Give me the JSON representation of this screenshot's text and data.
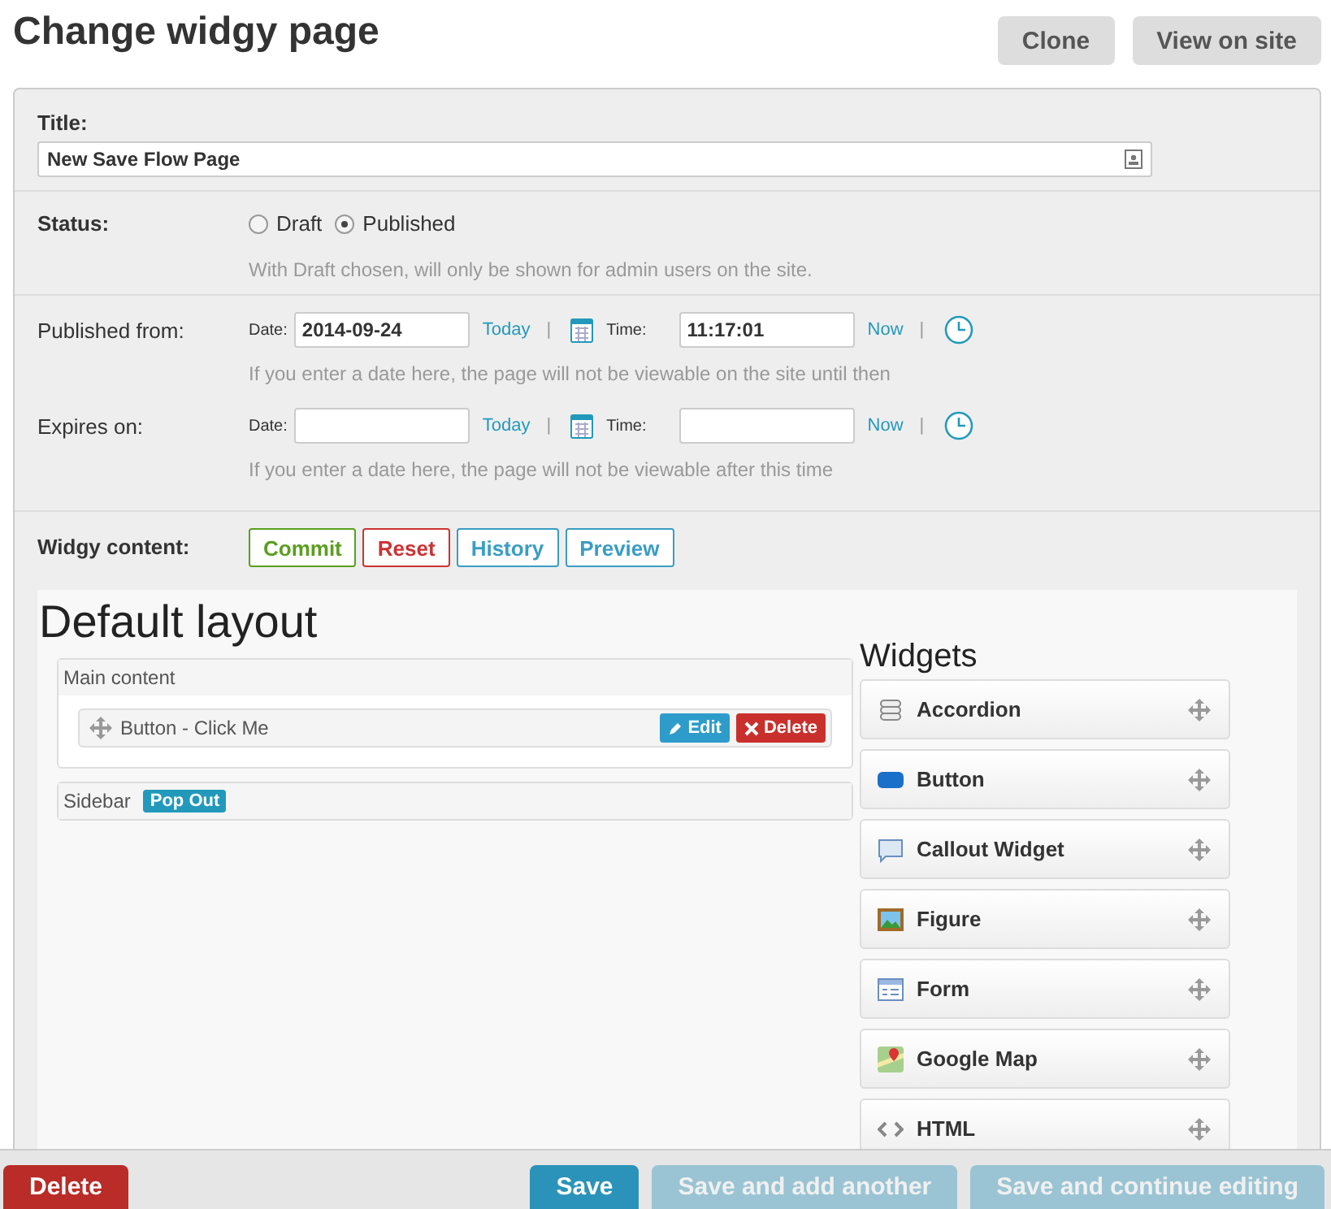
{
  "page_title": "Change widgy page",
  "header_buttons": [
    "Clone",
    "View on site"
  ],
  "title_field": {
    "label": "Title:",
    "value": "New Save Flow Page"
  },
  "status": {
    "label": "Status:",
    "options": [
      {
        "label": "Draft",
        "selected": false
      },
      {
        "label": "Published",
        "selected": true
      }
    ],
    "help": "With Draft chosen, will only be shown for admin users on the site."
  },
  "date_rows": [
    {
      "label": "Published from:",
      "date_label": "Date:",
      "date": "2014-09-24",
      "today": "Today",
      "today_separator": "|",
      "time_label": "Time:",
      "time": "11:17:01",
      "now": "Now",
      "now_separator": "|",
      "help": "If you enter a date here, the page will not be viewable on the site until then"
    },
    {
      "label": "Expires on:",
      "date_label": "Date:",
      "date": "",
      "today": "Today",
      "today_separator": "|",
      "time_label": "Time:",
      "time": "",
      "now": "Now",
      "now_separator": "|",
      "help": "If you enter a date here, the page will not be viewable after this time"
    }
  ],
  "widgy": {
    "label": "Widgy content:",
    "actions": [
      {
        "label": "Commit",
        "kind": "commit"
      },
      {
        "label": "Reset",
        "kind": "reset"
      },
      {
        "label": "History",
        "kind": "info"
      },
      {
        "label": "Preview",
        "kind": "info"
      }
    ],
    "layout_title": "Default layout",
    "regions": [
      {
        "title": "Main content",
        "items": [
          {
            "label": "Button - Click Me",
            "edit": "Edit",
            "delete": "Delete"
          }
        ]
      },
      {
        "title": "Sidebar",
        "badge": "Pop Out"
      }
    ],
    "widgets_title": "Widgets",
    "widgets": [
      "Accordion",
      "Button",
      "Callout Widget",
      "Figure",
      "Form",
      "Google Map",
      "HTML"
    ]
  },
  "footer": {
    "delete": "Delete",
    "buttons": [
      {
        "label": "Save",
        "disabled": false
      },
      {
        "label": "Save and add another",
        "disabled": true
      },
      {
        "label": "Save and continue editing",
        "disabled": true
      }
    ]
  }
}
